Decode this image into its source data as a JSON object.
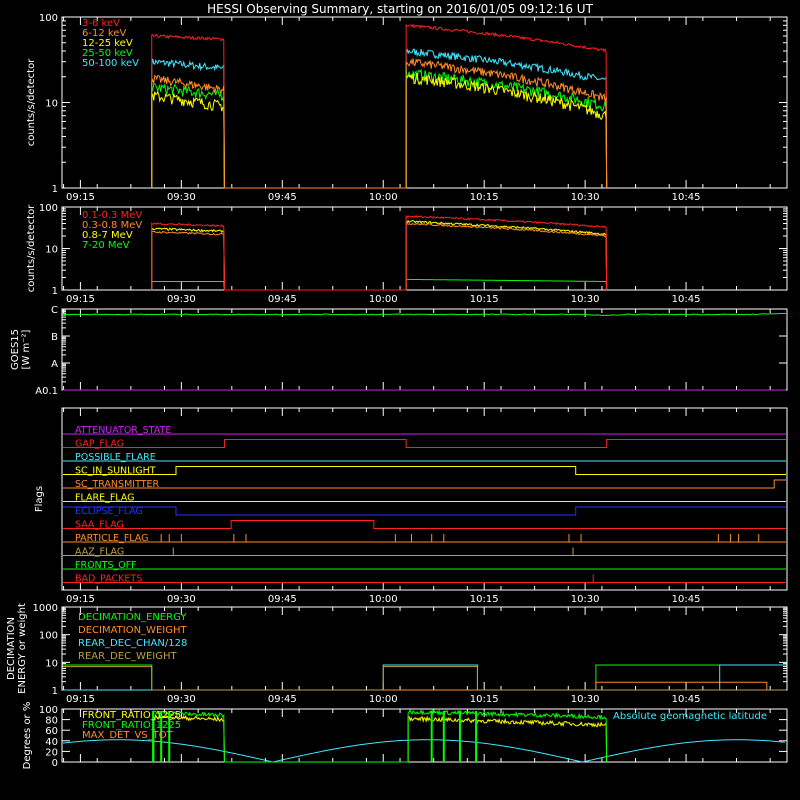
{
  "title": "HESSI Observing Summary, starting on 2016/01/05 09:12:16 UT",
  "colors": {
    "red": "#ff2020",
    "orange": "#ff8c28",
    "yellow": "#ffff00",
    "green": "#00ff00",
    "cyan": "#40e8ff",
    "magenta": "#cc22ee",
    "blue": "#2233ff",
    "olive": "#bba040",
    "white": "#ffffff",
    "axis": "#ffffff"
  },
  "chart_data": [
    {
      "id": "light-curves",
      "type": "line",
      "ylabel": "counts/s/detector",
      "yscale": "log",
      "ylim": [
        1,
        100
      ],
      "yticks": [
        {
          "v": 1,
          "label": "1"
        },
        {
          "v": 10,
          "label": "10"
        },
        {
          "v": 100,
          "label": "100"
        }
      ],
      "xlim": [
        9.2044,
        11.0
      ],
      "xticks": [
        {
          "h": 9.25,
          "label": "09:15"
        },
        {
          "h": 9.5,
          "label": "09:30"
        },
        {
          "h": 9.75,
          "label": "09:45"
        },
        {
          "h": 10.0,
          "label": "10:00"
        },
        {
          "h": 10.25,
          "label": "10:15"
        },
        {
          "h": 10.5,
          "label": "10:30"
        },
        {
          "h": 10.75,
          "label": "10:45"
        }
      ],
      "intervals": [
        [
          9.4267,
          9.6067
        ],
        [
          10.0567,
          10.5533
        ]
      ],
      "series": [
        {
          "name": "3-6 keV",
          "color": "red",
          "seg": [
            [
              60,
              55
            ],
            [
              80,
              40
            ]
          ],
          "noise": 0.04
        },
        {
          "name": "6-12 keV",
          "color": "orange",
          "seg": [
            [
              19,
              14
            ],
            [
              30,
              11
            ]
          ],
          "noise": 0.12
        },
        {
          "name": "12-25 keV",
          "color": "yellow",
          "seg": [
            [
              12,
              9
            ],
            [
              20,
              7
            ]
          ],
          "noise": 0.15
        },
        {
          "name": "25-50 keV",
          "color": "green",
          "seg": [
            [
              15,
              12
            ],
            [
              22,
              9
            ]
          ],
          "noise": 0.15
        },
        {
          "name": "50-100 keV",
          "color": "cyan",
          "seg": [
            [
              30,
              25
            ],
            [
              40,
              18
            ]
          ],
          "noise": 0.1
        }
      ]
    },
    {
      "id": "high-energy",
      "type": "line",
      "ylabel": "counts/s/detector",
      "yscale": "log",
      "ylim": [
        1,
        100
      ],
      "yticks": [
        {
          "v": 1,
          "label": "1"
        },
        {
          "v": 10,
          "label": "10"
        },
        {
          "v": 100,
          "label": "100"
        }
      ],
      "xlim": [
        9.2044,
        11.0
      ],
      "xticks": [
        {
          "h": 9.25,
          "label": "09:15"
        },
        {
          "h": 9.5,
          "label": "09:30"
        },
        {
          "h": 9.75,
          "label": "09:45"
        },
        {
          "h": 10.0,
          "label": "10:00"
        },
        {
          "h": 10.25,
          "label": "10:15"
        },
        {
          "h": 10.5,
          "label": "10:30"
        },
        {
          "h": 10.75,
          "label": "10:45"
        }
      ],
      "intervals": [
        [
          9.4267,
          9.6067
        ],
        [
          10.0567,
          10.5533
        ]
      ],
      "series": [
        {
          "name": "0.1-0.3 MeV",
          "color": "red",
          "seg": [
            [
              40,
              35
            ],
            [
              60,
              33
            ]
          ],
          "noise": 0.05
        },
        {
          "name": "0.3-0.8 MeV",
          "color": "orange",
          "seg": [
            [
              25,
              22
            ],
            [
              40,
              20
            ]
          ],
          "noise": 0.05
        },
        {
          "name": "0.8-7 MeV",
          "color": "yellow",
          "seg": [
            [
              30,
              26
            ],
            [
              45,
              22
            ]
          ],
          "noise": 0.06
        },
        {
          "name": "7-20 MeV",
          "color": "green",
          "seg": [
            [
              1.6,
              1.6
            ],
            [
              1.8,
              1.6
            ]
          ],
          "noise": 0.0
        }
      ]
    },
    {
      "id": "goes",
      "type": "line",
      "ylabel": "GOES15",
      "ylabel2": "[W m⁻²]",
      "yticks": [
        {
          "pos": 0,
          "label": "A0.1"
        },
        {
          "pos": 1,
          "label": "A"
        },
        {
          "pos": 2,
          "label": "B"
        },
        {
          "pos": 3,
          "label": "C"
        }
      ],
      "ylim": [
        0,
        3
      ],
      "xlim": [
        9.2044,
        11.0
      ],
      "series": [
        {
          "name": "GOES 1-8 A",
          "color": "green",
          "level": 2.8
        },
        {
          "name": "GOES 0.5-4 A",
          "color": "magenta",
          "level": 0.0
        }
      ]
    },
    {
      "id": "flags",
      "type": "line",
      "ylabel": "Flags",
      "xlim": [
        9.2044,
        11.0
      ],
      "xticks": [
        {
          "h": 9.25,
          "label": "09:15"
        },
        {
          "h": 9.5,
          "label": "09:30"
        },
        {
          "h": 9.75,
          "label": "09:45"
        },
        {
          "h": 10.0,
          "label": "10:00"
        },
        {
          "h": 10.25,
          "label": "10:15"
        },
        {
          "h": 10.5,
          "label": "10:30"
        },
        {
          "h": 10.75,
          "label": "10:45"
        }
      ],
      "flags": [
        {
          "name": "ATTENUATOR_STATE",
          "color": "magenta",
          "steps": [
            [
              9.2044,
              0
            ]
          ]
        },
        {
          "name": "GAP_FLAG",
          "color": "red",
          "steps": [
            [
              9.2044,
              0
            ],
            [
              9.6067,
              1
            ],
            [
              10.0567,
              0
            ],
            [
              10.5533,
              1
            ]
          ]
        },
        {
          "name": "POSSIBLE_FLARE",
          "color": "cyan",
          "steps": [
            [
              9.2044,
              0
            ]
          ]
        },
        {
          "name": "SC_IN_SUNLIGHT",
          "color": "yellow",
          "steps": [
            [
              9.2044,
              0
            ],
            [
              9.4867,
              1
            ],
            [
              10.4767,
              0
            ]
          ]
        },
        {
          "name": "SC_TRANSMITTER",
          "color": "orange",
          "steps": [
            [
              9.2044,
              0
            ],
            [
              10.9683,
              1
            ]
          ]
        },
        {
          "name": "FLARE_FLAG",
          "color": "yellow",
          "steps": [
            [
              9.2044,
              0
            ]
          ]
        },
        {
          "name": "ECLIPSE_FLAG",
          "color": "blue",
          "steps": [
            [
              9.2044,
              1
            ],
            [
              9.4867,
              0
            ],
            [
              10.4767,
              1
            ]
          ]
        },
        {
          "name": "SAA_FLAG",
          "color": "red",
          "steps": [
            [
              9.2044,
              0
            ],
            [
              9.6233,
              1
            ],
            [
              9.9767,
              0
            ]
          ]
        },
        {
          "name": "PARTICLE_FLAG",
          "color": "orange",
          "steps": [
            [
              9.2044,
              0
            ]
          ],
          "spikes": [
            9.45,
            9.47,
            9.5,
            9.63,
            9.66,
            10.03,
            10.07,
            10.12,
            10.15,
            10.46,
            10.49,
            10.83,
            10.86,
            10.88,
            10.93
          ]
        },
        {
          "name": "AAZ_FLAG",
          "color": "olive",
          "steps": [
            [
              9.2044,
              0
            ]
          ],
          "spikes": [
            9.48,
            10.47
          ]
        },
        {
          "name": "FRONTS_OFF",
          "color": "green",
          "steps": [
            [
              9.2044,
              0
            ]
          ]
        },
        {
          "name": "BAD_PACKETS",
          "color": "red",
          "steps": [
            [
              9.2044,
              0
            ]
          ],
          "spikes": [
            10.52
          ]
        }
      ]
    },
    {
      "id": "decimation",
      "type": "line",
      "ylabel": "DECIMATION",
      "ylabel2": "ENERGY or weight",
      "yscale": "log",
      "ylim": [
        1,
        1000
      ],
      "yticks": [
        {
          "v": 1,
          "label": "1"
        },
        {
          "v": 10,
          "label": "10"
        },
        {
          "v": 100,
          "label": "100"
        },
        {
          "v": 1000,
          "label": "1000"
        }
      ],
      "xlim": [
        9.2044,
        11.0
      ],
      "xticks": [
        {
          "h": 9.25,
          "label": "09:15"
        },
        {
          "h": 9.5,
          "label": "09:30"
        },
        {
          "h": 9.75,
          "label": "09:45"
        },
        {
          "h": 10.0,
          "label": "10:00"
        },
        {
          "h": 10.25,
          "label": "10:15"
        },
        {
          "h": 10.5,
          "label": "10:30"
        },
        {
          "h": 10.75,
          "label": "10:45"
        }
      ],
      "series": [
        {
          "name": "DECIMATION_ENERGY",
          "color": "green",
          "steps": [
            [
              9.2044,
              8
            ],
            [
              9.4267,
              1
            ],
            [
              10.5267,
              8
            ]
          ]
        },
        {
          "name": "DECIMATION_WEIGHT",
          "color": "orange",
          "steps": [
            [
              9.2044,
              1
            ],
            [
              10.5267,
              1.9
            ],
            [
              10.95,
              1
            ]
          ]
        },
        {
          "name": "REAR_DEC_CHAN/128",
          "color": "cyan",
          "steps": [
            [
              9.2044,
              1
            ],
            [
              10.0,
              8
            ],
            [
              10.2333,
              1
            ],
            [
              10.8333,
              8
            ]
          ]
        },
        {
          "name": "REAR_DEC_WEIGHT",
          "color": "olive",
          "steps": [
            [
              9.2044,
              7
            ],
            [
              9.4267,
              1
            ],
            [
              10.0,
              7
            ],
            [
              10.2333,
              1
            ]
          ]
        }
      ]
    },
    {
      "id": "ratios",
      "type": "line",
      "ylabel": "Degrees or %",
      "ylim": [
        0,
        100
      ],
      "yticks": [
        {
          "v": 0,
          "label": "0"
        },
        {
          "v": 20,
          "label": "20"
        },
        {
          "v": 40,
          "label": "40"
        },
        {
          "v": 60,
          "label": "60"
        },
        {
          "v": 80,
          "label": "80"
        },
        {
          "v": 100,
          "label": "100"
        }
      ],
      "xlim": [
        9.2044,
        11.0
      ],
      "annotation": "Absolute geomagnetic latitude",
      "series": [
        {
          "name": "FRONT_RATIO_1225",
          "color": "yellow",
          "seg": [
            [
              85,
              80
            ],
            [
              82,
              70
            ]
          ]
        },
        {
          "name": "FRONT_RATIO_1225",
          "color": "green",
          "seg": [
            [
              93,
              88
            ],
            [
              95,
              85
            ]
          ]
        },
        {
          "name": "MAX_DET_VS_TOT",
          "color": "orange",
          "seg": [
            [
              0,
              0
            ],
            [
              0,
              0
            ]
          ]
        }
      ],
      "latitude": {
        "name": "Absolute geomagnetic latitude",
        "color": "cyan",
        "max": 42,
        "zeros": [
          9.7267,
          10.4933
        ],
        "peaks": [
          9.1667,
          10.11,
          10.9467
        ]
      }
    }
  ]
}
